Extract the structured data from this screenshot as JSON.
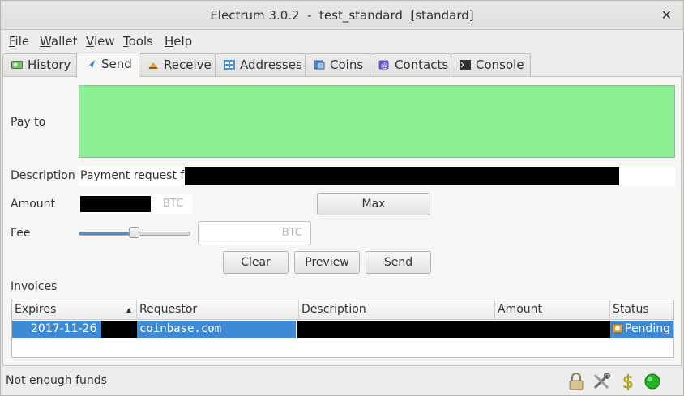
{
  "window": {
    "title": "Electrum 3.0.2  -  test_standard  [standard]",
    "close_glyph": "✕"
  },
  "menu": [
    {
      "label": "File",
      "accel": "F",
      "rest": "ile"
    },
    {
      "label": "Wallet",
      "accel": "W",
      "rest": "allet"
    },
    {
      "label": "View",
      "accel": "V",
      "rest": "iew"
    },
    {
      "label": "Tools",
      "accel": "T",
      "rest": "ools"
    },
    {
      "label": "Help",
      "accel": "H",
      "rest": "elp"
    }
  ],
  "tabs": [
    {
      "label": "History",
      "icon": "history-icon"
    },
    {
      "label": "Send",
      "icon": "send-icon",
      "active": true
    },
    {
      "label": "Receive",
      "icon": "receive-icon"
    },
    {
      "label": "Addresses",
      "icon": "addresses-icon"
    },
    {
      "label": "Coins",
      "icon": "coins-icon"
    },
    {
      "label": "Contacts",
      "icon": "contacts-icon"
    },
    {
      "label": "Console",
      "icon": "console-icon"
    }
  ],
  "send": {
    "pay_to_label": "Pay to",
    "pay_to_value": "",
    "description_label": "Description",
    "description_value": "Payment request for",
    "amount_label": "Amount",
    "amount_unit": "BTC",
    "max_label": "Max",
    "fee_label": "Fee",
    "fee_unit": "BTC",
    "fee_slider_level": 0.5,
    "clear_label": "Clear",
    "preview_label": "Preview",
    "send_label": "Send",
    "pay_to_color": "#8ef095"
  },
  "invoices": {
    "title": "Invoices",
    "columns": [
      "Expires",
      "Requestor",
      "Description",
      "Amount",
      "Status"
    ],
    "sort_indicator": "▲",
    "rows": [
      {
        "expires": "2017-11-26",
        "requestor": "coinbase.com",
        "description": "",
        "amount": "",
        "status": "Pending"
      }
    ],
    "selection_color": "#3f8ad6"
  },
  "status": {
    "message": "Not enough funds",
    "icons": [
      "lock-icon",
      "preferences-icon",
      "seed-icon",
      "network-status-icon"
    ],
    "network_color": "#22b422"
  }
}
